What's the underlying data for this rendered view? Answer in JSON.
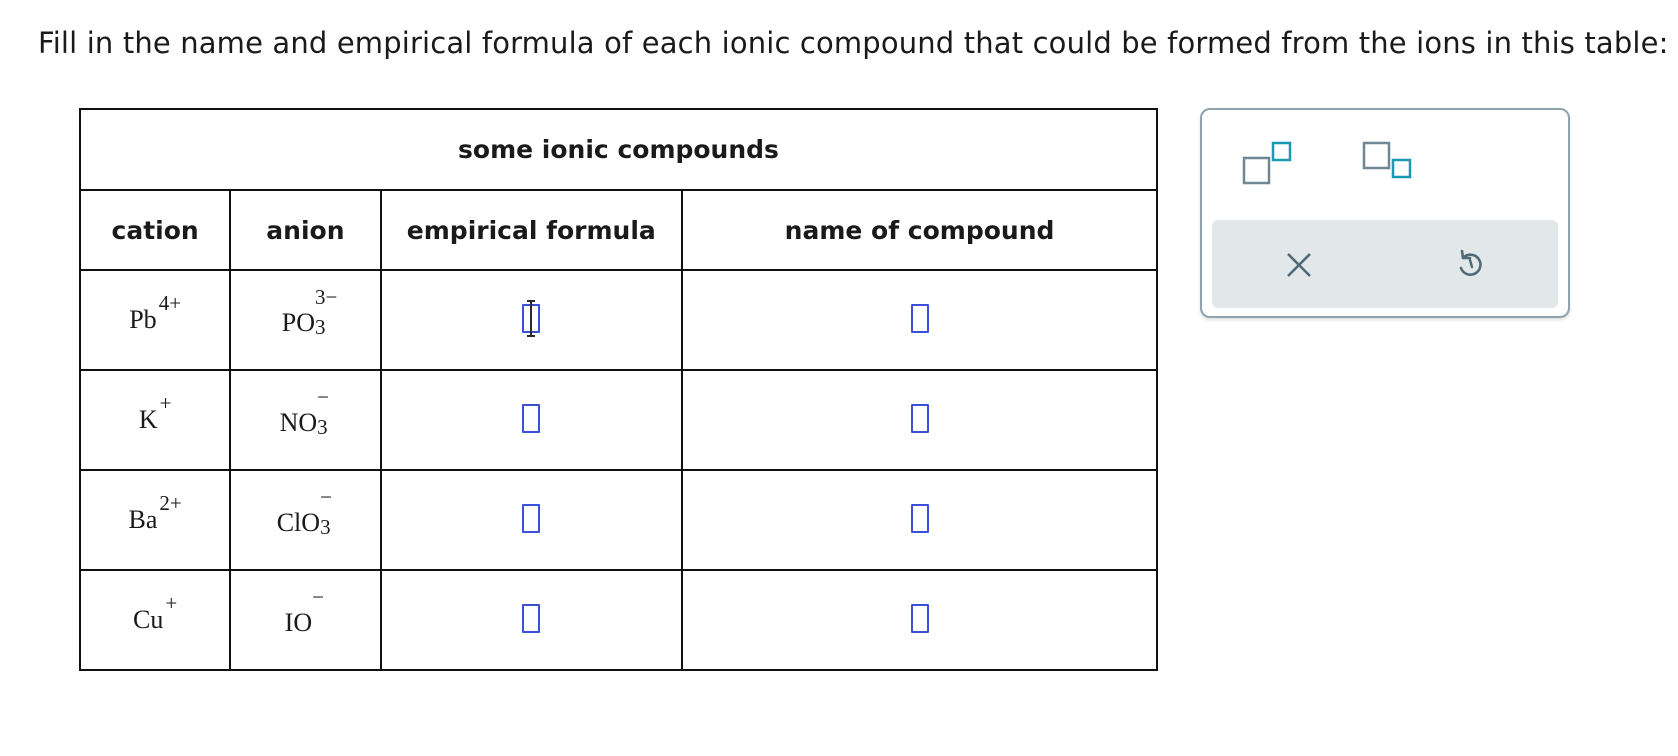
{
  "prompt": "Fill in the name and empirical formula of each ionic compound that could be formed from the ions in this table:",
  "table": {
    "title": "some ionic compounds",
    "headers": {
      "cation": "cation",
      "anion": "anion",
      "formula": "empirical formula",
      "name": "name of compound"
    },
    "rows": [
      {
        "cation_symbol": "Pb",
        "cation_charge": "4+",
        "anion_symbol": "PO",
        "anion_subscript": "3",
        "anion_charge": "3−",
        "formula_value": "",
        "name_value": ""
      },
      {
        "cation_symbol": "K",
        "cation_charge": "+",
        "anion_symbol": "NO",
        "anion_subscript": "3",
        "anion_charge": "−",
        "formula_value": "",
        "name_value": ""
      },
      {
        "cation_symbol": "Ba",
        "cation_charge": "2+",
        "anion_symbol": "ClO",
        "anion_subscript": "3",
        "anion_charge": "−",
        "formula_value": "",
        "name_value": ""
      },
      {
        "cation_symbol": "Cu",
        "cation_charge": "+",
        "anion_symbol": "IO",
        "anion_subscript": "",
        "anion_charge": "−",
        "formula_value": "",
        "name_value": ""
      }
    ]
  },
  "toolbar": {
    "superscript_icon": "superscript-icon",
    "subscript_icon": "subscript-icon",
    "clear_icon": "close-icon",
    "undo_icon": "undo-icon"
  },
  "colors": {
    "input_border": "#3b4fd8",
    "tool_accent": "#1b9bb3",
    "tool_gray": "#6f8893",
    "panel_footer": "#e2e8ea"
  }
}
